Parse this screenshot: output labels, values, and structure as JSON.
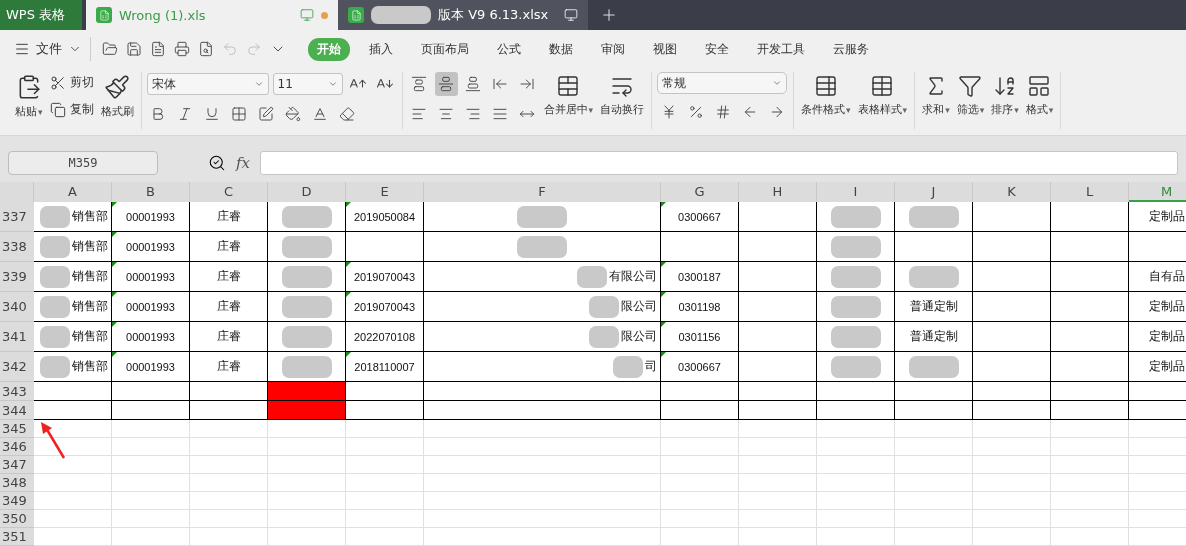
{
  "window_tabs": [
    {
      "kind": "app",
      "label": "WPS 表格",
      "selected": false
    },
    {
      "kind": "file",
      "label": "Wrong (1).xls",
      "selected": true,
      "modified": true,
      "redacted": false
    },
    {
      "kind": "file",
      "label": "版本 V9 6.13.xlsx",
      "selected": false,
      "modified": false,
      "redacted": true
    }
  ],
  "menu": {
    "file": "文件",
    "tabs": [
      {
        "label": "开始",
        "selected": true
      },
      {
        "label": "插入",
        "selected": false
      },
      {
        "label": "页面布局",
        "selected": false
      },
      {
        "label": "公式",
        "selected": false
      },
      {
        "label": "数据",
        "selected": false
      },
      {
        "label": "审阅",
        "selected": false
      },
      {
        "label": "视图",
        "selected": false
      },
      {
        "label": "安全",
        "selected": false
      },
      {
        "label": "开发工具",
        "selected": false
      },
      {
        "label": "云服务",
        "selected": false
      }
    ]
  },
  "ribbon": {
    "paste": "粘贴",
    "cut": "剪切",
    "copy": "复制",
    "format_painter": "格式刷",
    "font": "宋体",
    "font_size": "11",
    "vertical_align": [
      {
        "selected": false
      },
      {
        "selected": true
      },
      {
        "selected": false
      }
    ],
    "merge": "合并居中",
    "wrap": "自动换行",
    "number_format": "常规",
    "conditional": "条件格式",
    "table_style": "表格样式",
    "sum": "求和",
    "filter": "筛选",
    "sort": "排序",
    "format": "格式",
    "dropdown_caret": "▾"
  },
  "formula_bar": {
    "name_box": "M359",
    "fx_label": "fx"
  },
  "columns": [
    {
      "label": "A",
      "selected": false
    },
    {
      "label": "B",
      "selected": false
    },
    {
      "label": "C",
      "selected": false
    },
    {
      "label": "D",
      "selected": false
    },
    {
      "label": "E",
      "selected": false
    },
    {
      "label": "F",
      "selected": false
    },
    {
      "label": "G",
      "selected": false
    },
    {
      "label": "H",
      "selected": false
    },
    {
      "label": "I",
      "selected": false
    },
    {
      "label": "J",
      "selected": false
    },
    {
      "label": "K",
      "selected": false
    },
    {
      "label": "L",
      "selected": false
    },
    {
      "label": "M",
      "selected": true
    }
  ],
  "rows": [
    {
      "header": "337",
      "cells": [
        {
          "text": "销售部",
          "flagged": false,
          "redacted": true
        },
        {
          "text": "00001993",
          "flagged": true,
          "redacted": false
        },
        {
          "text": "庄睿",
          "flagged": false,
          "redacted": false
        },
        {
          "flagged": false,
          "redacted": true
        },
        {
          "text": "2019050084",
          "flagged": true,
          "redacted": false
        },
        {
          "flagged": false,
          "redacted": true
        },
        {
          "text": "0300667",
          "flagged": true,
          "redacted": false
        },
        {
          "flagged": false,
          "redacted": false
        },
        {
          "flagged": false,
          "redacted": true
        },
        {
          "flagged": false,
          "redacted": true
        },
        {
          "flagged": false,
          "redacted": false
        },
        {
          "flagged": false,
          "redacted": false
        },
        {
          "text": "定制品",
          "flagged": false,
          "redacted": false
        }
      ]
    },
    {
      "header": "338",
      "cells": [
        {
          "text": "销售部",
          "flagged": false,
          "redacted": true
        },
        {
          "text": "00001993",
          "flagged": true,
          "redacted": false
        },
        {
          "text": "庄睿",
          "flagged": false,
          "redacted": false
        },
        {
          "flagged": false,
          "redacted": true
        },
        {
          "flagged": false,
          "redacted": false
        },
        {
          "flagged": false,
          "redacted": true
        },
        {
          "flagged": false,
          "redacted": false
        },
        {
          "flagged": false,
          "redacted": false
        },
        {
          "flagged": false,
          "redacted": true
        },
        {
          "flagged": false,
          "redacted": false
        },
        {
          "flagged": false,
          "redacted": false
        },
        {
          "flagged": false,
          "redacted": false
        },
        {
          "flagged": false,
          "redacted": false
        }
      ]
    },
    {
      "header": "339",
      "cells": [
        {
          "text": "销售部",
          "flagged": false,
          "redacted": true
        },
        {
          "text": "00001993",
          "flagged": true,
          "redacted": false
        },
        {
          "text": "庄睿",
          "flagged": false,
          "redacted": false
        },
        {
          "flagged": false,
          "redacted": true
        },
        {
          "text": "2019070043",
          "flagged": true,
          "redacted": false
        },
        {
          "text": "有限公司",
          "flagged": false,
          "redacted": true
        },
        {
          "text": "0300187",
          "flagged": true,
          "redacted": false
        },
        {
          "flagged": false,
          "redacted": false
        },
        {
          "flagged": false,
          "redacted": true
        },
        {
          "flagged": false,
          "redacted": true
        },
        {
          "flagged": false,
          "redacted": false
        },
        {
          "flagged": false,
          "redacted": false
        },
        {
          "text": "自有品",
          "flagged": false,
          "redacted": false
        }
      ]
    },
    {
      "header": "340",
      "cells": [
        {
          "text": "销售部",
          "flagged": false,
          "redacted": true
        },
        {
          "text": "00001993",
          "flagged": true,
          "redacted": false
        },
        {
          "text": "庄睿",
          "flagged": false,
          "redacted": false
        },
        {
          "flagged": false,
          "redacted": true
        },
        {
          "text": "2019070043",
          "flagged": true,
          "redacted": false
        },
        {
          "text": "限公司",
          "flagged": false,
          "redacted": true
        },
        {
          "text": "0301198",
          "flagged": true,
          "redacted": false
        },
        {
          "flagged": false,
          "redacted": false
        },
        {
          "flagged": false,
          "redacted": true
        },
        {
          "text": "普通定制",
          "flagged": false,
          "redacted": false
        },
        {
          "flagged": false,
          "redacted": false
        },
        {
          "flagged": false,
          "redacted": false
        },
        {
          "text": "定制品",
          "flagged": false,
          "redacted": false
        }
      ]
    },
    {
      "header": "341",
      "cells": [
        {
          "text": "销售部",
          "flagged": false,
          "redacted": true
        },
        {
          "text": "00001993",
          "flagged": true,
          "redacted": false
        },
        {
          "text": "庄睿",
          "flagged": false,
          "redacted": false
        },
        {
          "flagged": false,
          "redacted": true
        },
        {
          "text": "2022070108",
          "flagged": false,
          "redacted": false
        },
        {
          "text": "限公司",
          "flagged": false,
          "redacted": true
        },
        {
          "text": "0301156",
          "flagged": true,
          "redacted": false
        },
        {
          "flagged": false,
          "redacted": false
        },
        {
          "flagged": false,
          "redacted": true
        },
        {
          "text": "普通定制",
          "flagged": false,
          "redacted": false
        },
        {
          "flagged": false,
          "redacted": false
        },
        {
          "flagged": false,
          "redacted": false
        },
        {
          "text": "定制品",
          "flagged": false,
          "redacted": false
        }
      ]
    },
    {
      "header": "342",
      "cells": [
        {
          "text": "销售部",
          "flagged": false,
          "redacted": true
        },
        {
          "text": "00001993",
          "flagged": true,
          "redacted": false
        },
        {
          "text": "庄睿",
          "flagged": false,
          "redacted": false
        },
        {
          "flagged": false,
          "redacted": true
        },
        {
          "text": "2018110007",
          "flagged": true,
          "redacted": false
        },
        {
          "text": "司",
          "flagged": false,
          "redacted": true
        },
        {
          "text": "0300667",
          "flagged": true,
          "redacted": false
        },
        {
          "flagged": false,
          "redacted": false
        },
        {
          "flagged": false,
          "redacted": true
        },
        {
          "flagged": false,
          "redacted": true
        },
        {
          "flagged": false,
          "redacted": false
        },
        {
          "flagged": false,
          "redacted": false
        },
        {
          "text": "定制品",
          "flagged": false,
          "redacted": false
        }
      ]
    },
    {
      "header": "343",
      "cells": [
        {},
        {},
        {},
        {
          "color": "#ff0000"
        }
      ]
    },
    {
      "header": "344",
      "cells": [
        {},
        {},
        {},
        {
          "color": "#ff0000"
        }
      ]
    },
    {
      "header": "345",
      "cells": []
    },
    {
      "header": "346",
      "cells": []
    },
    {
      "header": "347",
      "cells": []
    },
    {
      "header": "348",
      "cells": []
    },
    {
      "header": "349",
      "cells": []
    },
    {
      "header": "350",
      "cells": []
    },
    {
      "header": "351",
      "cells": []
    }
  ]
}
